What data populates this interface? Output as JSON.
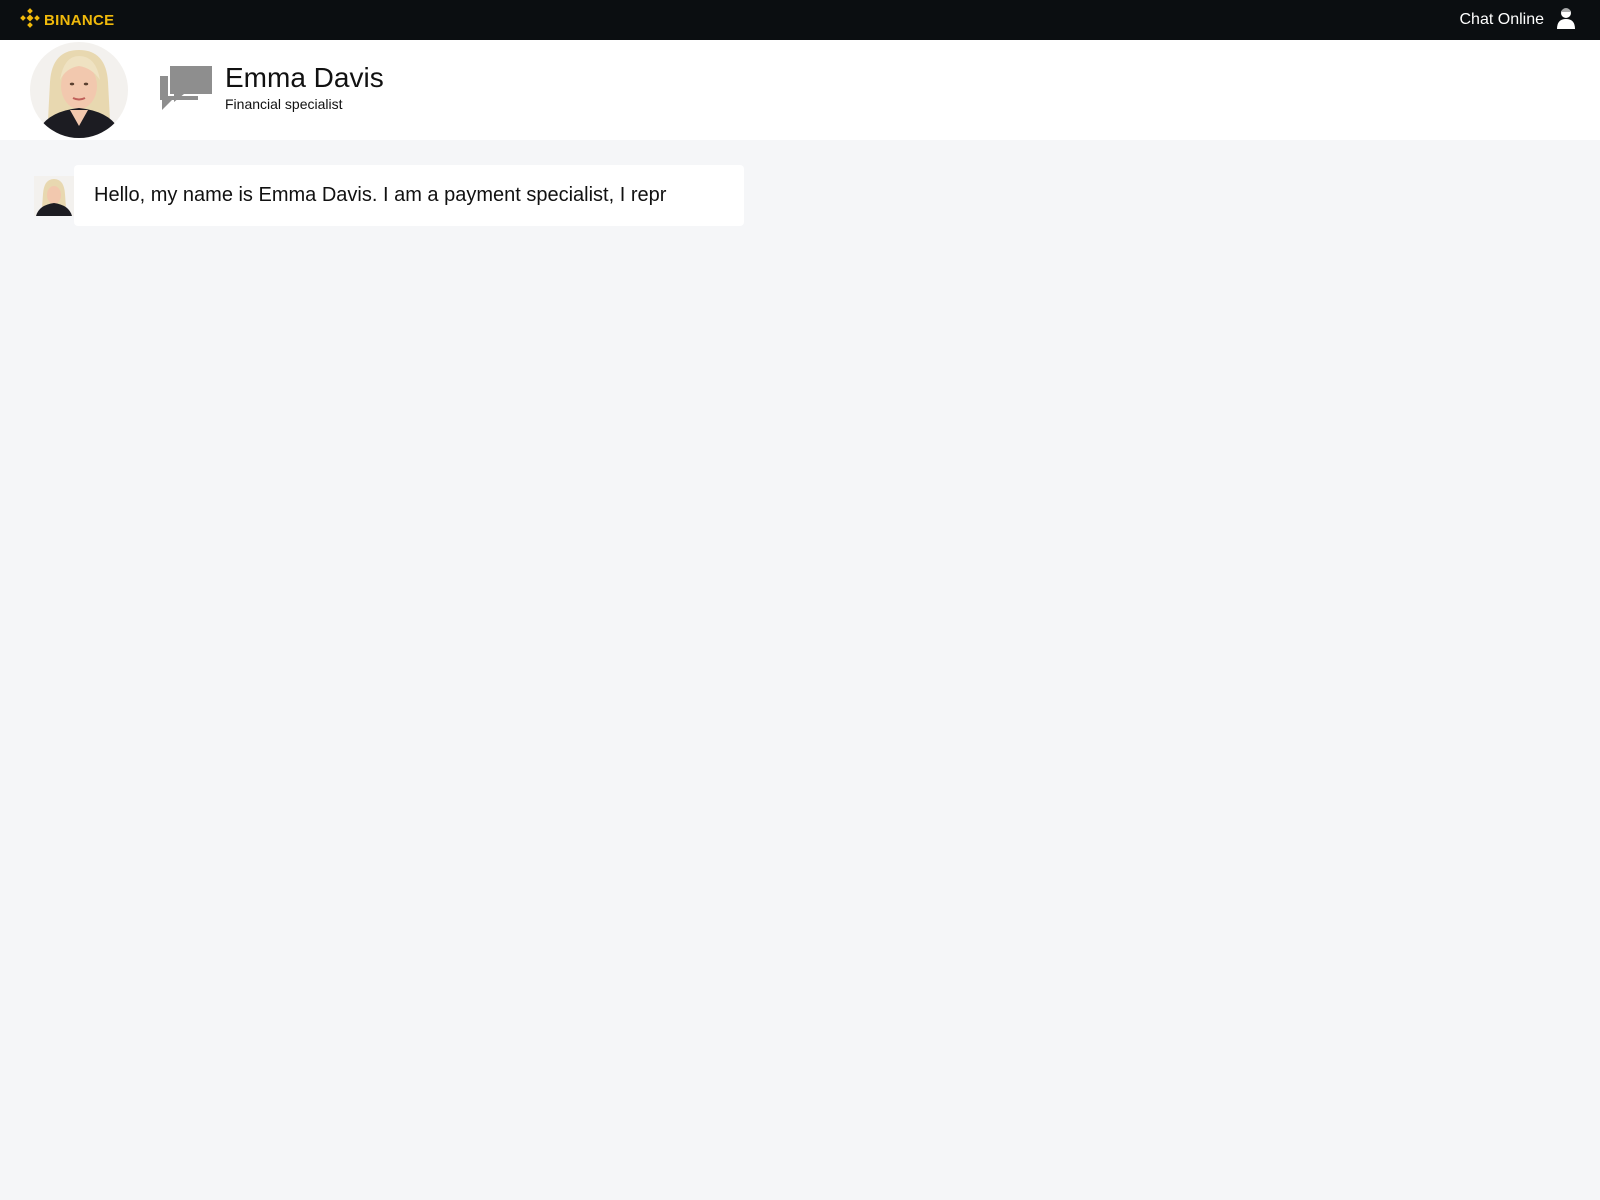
{
  "topbar": {
    "brand": "BINANCE",
    "brand_color": "#f0b90b",
    "status_label": "Chat Online",
    "logo_icon": "binance-logo-icon",
    "user_icon": "user-icon"
  },
  "agent": {
    "name": "Emma Davis",
    "role": "Financial specialist",
    "avatar_icon": "agent-avatar",
    "chat_icon": "chat-bubbles-icon"
  },
  "messages": [
    {
      "sender": "agent",
      "text": "Hello, my name is Emma Davis. I am a payment specialist, I repr"
    }
  ]
}
